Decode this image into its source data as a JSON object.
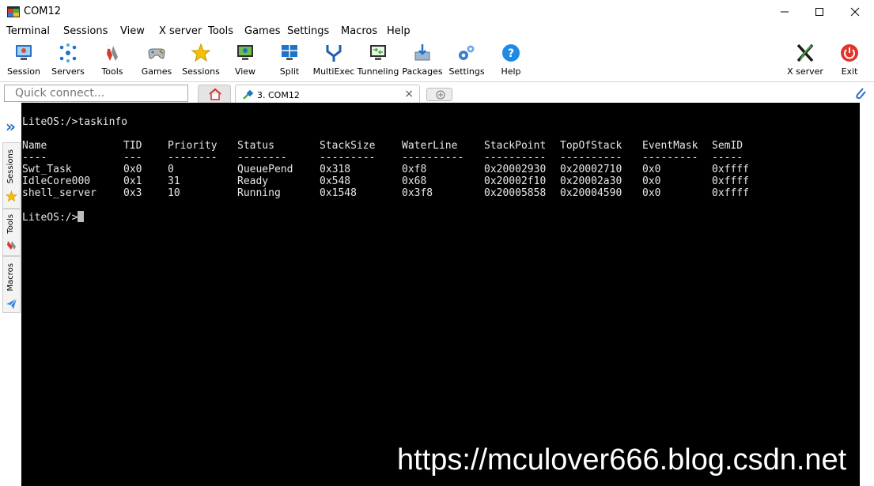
{
  "window": {
    "title": "COM12",
    "minimize_label": "—",
    "maximize_label": "☐",
    "close_label": "✕"
  },
  "menu": [
    "Terminal",
    "Sessions",
    "View",
    "X server",
    "Tools",
    "Games",
    "Settings",
    "Macros",
    "Help"
  ],
  "toolbar": {
    "items": [
      {
        "label": "Session",
        "icon": "session-icon"
      },
      {
        "label": "Servers",
        "icon": "servers-icon"
      },
      {
        "label": "Tools",
        "icon": "tools-icon"
      },
      {
        "label": "Games",
        "icon": "games-icon"
      },
      {
        "label": "Sessions",
        "icon": "star-icon"
      },
      {
        "label": "View",
        "icon": "view-icon"
      },
      {
        "label": "Split",
        "icon": "split-icon"
      },
      {
        "label": "MultiExec",
        "icon": "multiexec-icon"
      },
      {
        "label": "Tunneling",
        "icon": "tunneling-icon"
      },
      {
        "label": "Packages",
        "icon": "packages-icon"
      },
      {
        "label": "Settings",
        "icon": "settings-icon"
      },
      {
        "label": "Help",
        "icon": "help-icon"
      }
    ],
    "xserver_label": "X server",
    "exit_label": "Exit"
  },
  "tabs": {
    "quick_connect_placeholder": "Quick connect...",
    "session_tab_label": "3. COM12",
    "session_tab_close": "×"
  },
  "sidebar": {
    "toggle": "»",
    "tabs": [
      "Sessions",
      "Tools",
      "Macros"
    ]
  },
  "terminal": {
    "command_line": "LiteOS:/>taskinfo",
    "columns": [
      "Name",
      "TID",
      "Priority",
      "Status",
      "StackSize",
      "WaterLine",
      "StackPoint",
      "TopOfStack",
      "EventMask",
      "SemID"
    ],
    "separators": [
      "----",
      "---",
      "--------",
      "--------",
      "---------",
      "----------",
      "----------",
      "----------",
      "---------",
      "-----"
    ],
    "rows": [
      [
        "Swt_Task",
        "0x0",
        "0",
        "QueuePend",
        "0x318",
        "0xf8",
        "0x20002930",
        "0x20002710",
        "0x0",
        "0xffff"
      ],
      [
        "IdleCore000",
        "0x1",
        "31",
        "Ready",
        "0x548",
        "0x68",
        "0x20002f10",
        "0x20002a30",
        "0x0",
        "0xffff"
      ],
      [
        "shell_server",
        "0x3",
        "10",
        "Running",
        "0x1548",
        "0x3f8",
        "0x20005858",
        "0x20004590",
        "0x0",
        "0xffff"
      ]
    ],
    "prompt": "LiteOS:/>"
  },
  "watermark": "https://mculover666.blog.csdn.net",
  "colors": {
    "terminal_bg": "#000000",
    "terminal_fg": "#e8e8e8",
    "accent": "#1e74c9"
  }
}
